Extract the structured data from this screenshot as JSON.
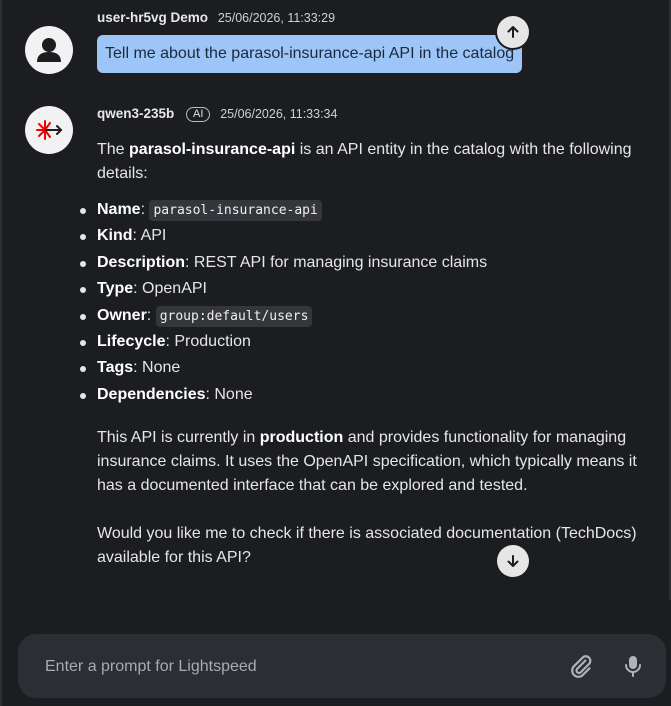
{
  "user_message": {
    "author": "user-hr5vg Demo",
    "timestamp": "25/06/2026, 11:33:29",
    "text": "Tell me about the parasol-insurance-api API in the catalog"
  },
  "bot_message": {
    "author": "qwen3-235b",
    "badge": "AI",
    "timestamp": "25/06/2026, 11:33:34",
    "intro_prefix": "The ",
    "intro_bold": "parasol-insurance-api",
    "intro_suffix": " is an API entity in the catalog with the following details:",
    "details": [
      {
        "label": "Name",
        "sep": ": ",
        "value": "parasol-insurance-api",
        "code": true
      },
      {
        "label": "Kind",
        "sep": ": ",
        "value": "API",
        "code": false
      },
      {
        "label": "Description",
        "sep": ": ",
        "value": "REST API for managing insurance claims",
        "code": false
      },
      {
        "label": "Type",
        "sep": ": ",
        "value": "OpenAPI",
        "code": false
      },
      {
        "label": "Owner",
        "sep": ": ",
        "value": "group:default/users",
        "code": true
      },
      {
        "label": "Lifecycle",
        "sep": ": ",
        "value": "Production",
        "code": false
      },
      {
        "label": "Tags",
        "sep": ": ",
        "value": "None",
        "code": false
      },
      {
        "label": "Dependencies",
        "sep": ": ",
        "value": "None",
        "code": false
      }
    ],
    "para2_prefix": "This API is currently in ",
    "para2_bold": "production",
    "para2_suffix": " and provides functionality for managing insurance claims. It uses the OpenAPI specification, which typically means it has a documented interface that can be explored and tested.",
    "para3": "Would you like me to check if there is associated documentation (TechDocs) available for this API?"
  },
  "composer": {
    "placeholder": "Enter a prompt for Lightspeed"
  },
  "icons": {
    "user_avatar": "person-icon",
    "bot_avatar": "lightspeed-logo-icon",
    "scroll_up": "arrow-up-icon",
    "scroll_down": "arrow-down-icon",
    "attach": "paperclip-icon",
    "mic": "microphone-icon"
  },
  "colors": {
    "background": "#1b1d21",
    "user_bubble": "#9ec5f8",
    "composer": "#2c2e33",
    "logo_red": "#ee0000"
  }
}
